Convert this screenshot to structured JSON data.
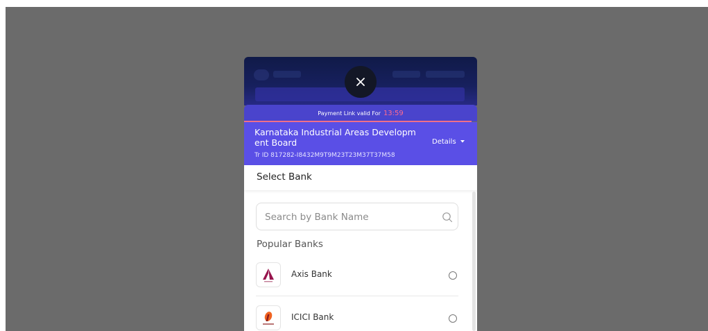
{
  "timer": {
    "label": "Payment Link valid For",
    "time": "13:59"
  },
  "merchant": {
    "name": "Karnataka Industrial Areas Developm ent Board",
    "tr_id": "Tr ID 817282-I8432M9T9M23T23M37T37M58",
    "details_label": "Details"
  },
  "select_bank": {
    "title": "Select Bank",
    "search_placeholder": "Search by Bank Name",
    "popular_label": "Popular Banks",
    "banks": [
      {
        "name": "Axis Bank",
        "logo": "axis-bank-logo"
      },
      {
        "name": "ICICI Bank",
        "logo": "icici-bank-logo"
      }
    ]
  },
  "colors": {
    "overlay": "#6b6b6b",
    "merchant_bg": "#5a4fe6",
    "timer_bg": "#4a44cc",
    "timer_accent": "#ff6b8f",
    "axis_maroon": "#97144d",
    "icici_orange": "#f06321"
  }
}
